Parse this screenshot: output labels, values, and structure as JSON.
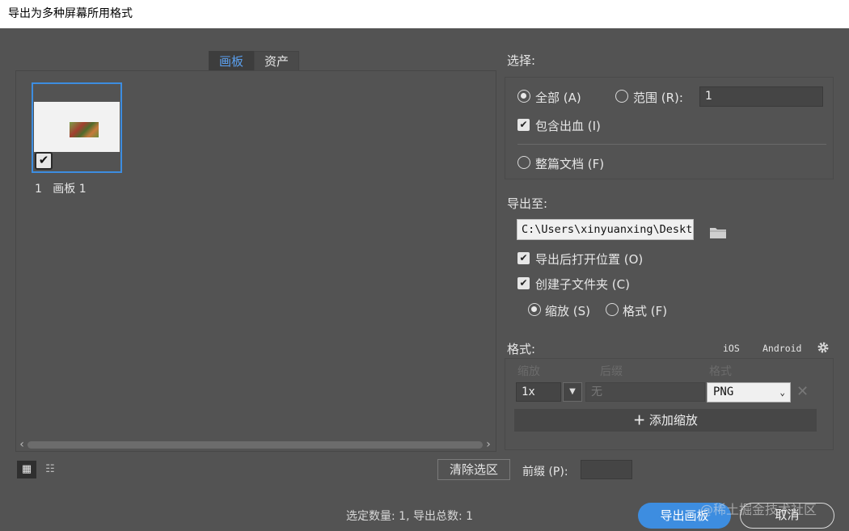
{
  "window": {
    "title": "导出为多种屏幕所用格式"
  },
  "tabs": [
    {
      "label": "画板"
    },
    {
      "label": "资产"
    }
  ],
  "artboards": [
    {
      "number": "1",
      "name": "画板 1",
      "checked": true
    }
  ],
  "view_toggle": {
    "grid_icon": "grid-view-icon",
    "list_icon": "list-view-icon"
  },
  "bottom_left": {
    "clear_label": "清除选区",
    "prefix_label": "前缀 (P):",
    "prefix_value": ""
  },
  "select": {
    "label": "选择:",
    "all_label": "全部 (A)",
    "range_label": "范围 (R):",
    "range_value": "1",
    "bleed_label": "包含出血 (I)",
    "whole_doc_label": "整篇文档 (F)"
  },
  "export_to": {
    "label": "导出至:",
    "path": "C:\\Users\\xinyuanxing\\Deskt",
    "open_after_label": "导出后打开位置 (O)",
    "subfolder_label": "创建子文件夹 (C)",
    "scale_label": "缩放 (S)",
    "format_label": "格式 (F)"
  },
  "formats": {
    "label": "格式:",
    "ios_label": "iOS",
    "android_label": "Android",
    "col_scale": "缩放",
    "col_suffix": "后缀",
    "col_format": "格式",
    "rows": [
      {
        "scale": "1x",
        "suffix": "无",
        "format": "PNG"
      }
    ],
    "add_label": "添加缩放"
  },
  "footer": {
    "count_text": "选定数量: 1, 导出总数: 1",
    "export_label": "导出画板",
    "cancel_label": "取消",
    "watermark": "@稀土掘金技术社区"
  },
  "colors": {
    "accent": "#3d8de0",
    "panel": "#535353"
  }
}
